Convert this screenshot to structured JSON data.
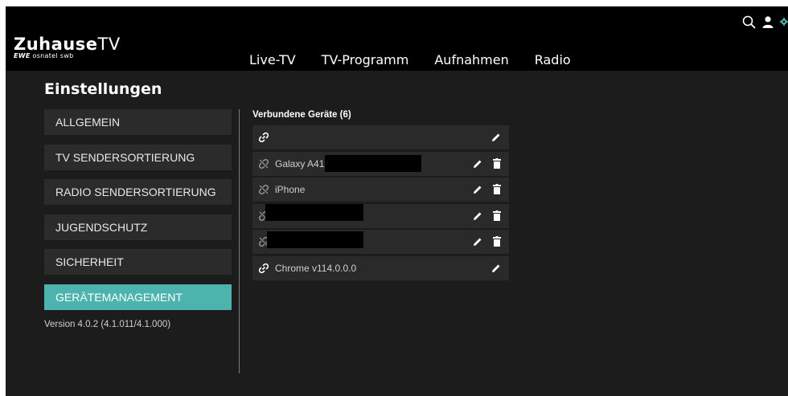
{
  "header": {
    "logo_main": "Zuhause",
    "logo_tv": "TV",
    "logo_sub_brand": "EWE",
    "logo_sub_rest": "osnatel swb",
    "nav": [
      "Live-TV",
      "TV-Programm",
      "Aufnahmen",
      "Radio"
    ],
    "icons": [
      "search-icon",
      "user-icon",
      "gear-icon"
    ]
  },
  "settings": {
    "title": "Einstellungen",
    "menu": [
      "ALLGEMEIN",
      "TV SENDERSORTIERUNG",
      "RADIO SENDERSORTIERUNG",
      "JUGENDSCHUTZ",
      "SICHERHEIT",
      "GERÄTEMANAGEMENT"
    ],
    "active_item": "GERÄTEMANAGEMENT",
    "version": "Version 4.0.2 (4.1.011/4.1.000)"
  },
  "devices": {
    "title": "Verbundene Geräte (6)",
    "items": [
      {
        "name": "",
        "connected": true,
        "deletable": false,
        "redacted": false
      },
      {
        "name": "Galaxy A41",
        "connected": false,
        "deletable": true,
        "redacted": true
      },
      {
        "name": "iPhone",
        "connected": false,
        "deletable": true,
        "redacted": false
      },
      {
        "name": "",
        "connected": false,
        "deletable": true,
        "redacted": true
      },
      {
        "name": "",
        "connected": false,
        "deletable": true,
        "redacted": true
      },
      {
        "name": "Chrome v114.0.0.0",
        "connected": true,
        "deletable": false,
        "redacted": false
      }
    ]
  },
  "colors": {
    "accent": "#4cb3ad",
    "background": "#1c1c1c",
    "header": "#000000",
    "row": "#2a2a2a"
  }
}
